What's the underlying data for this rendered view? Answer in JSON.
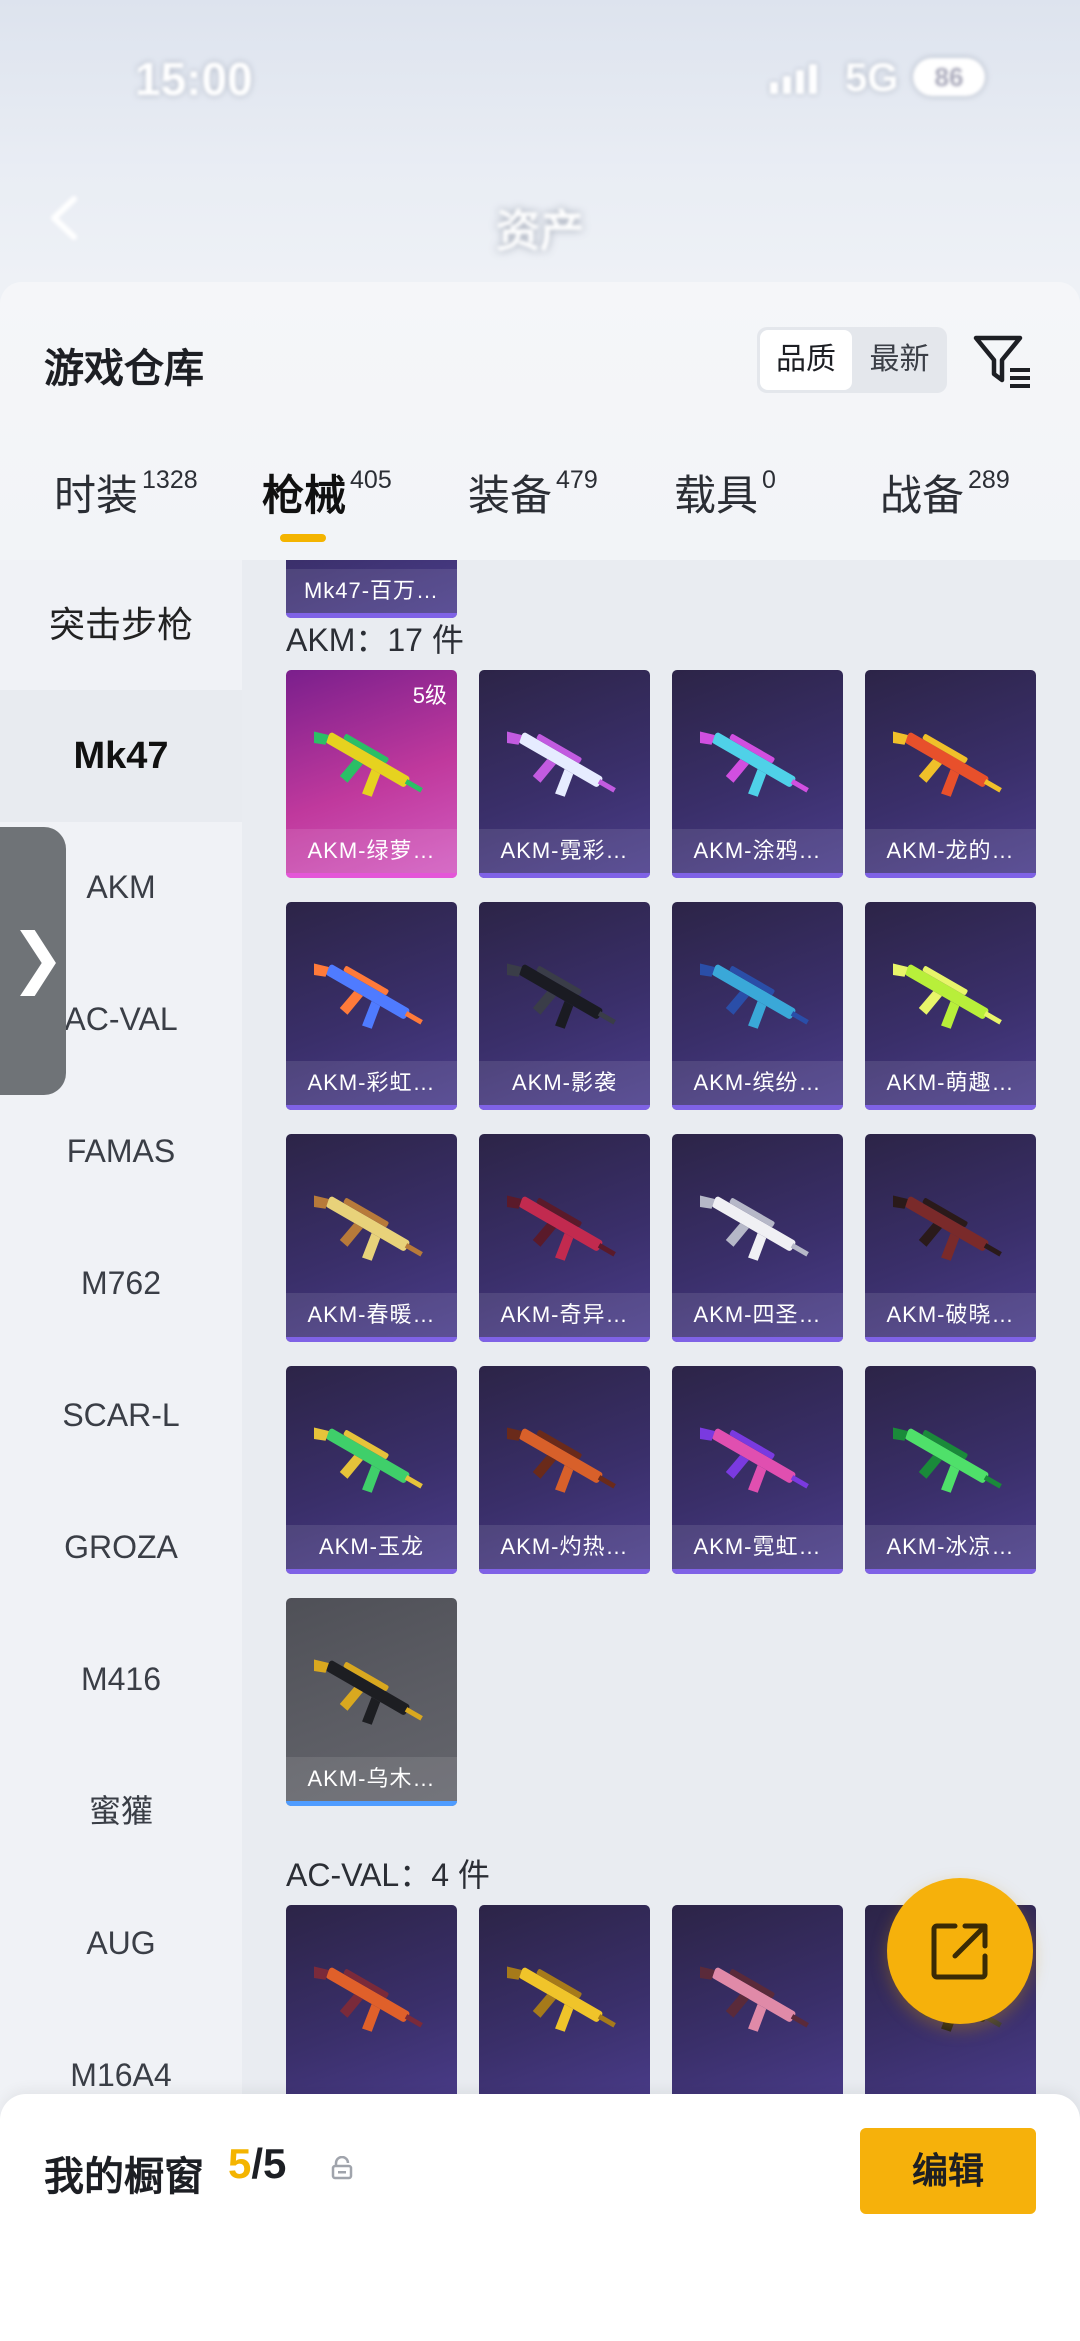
{
  "status_bar": {
    "time": "15:00",
    "network": "5G",
    "battery": "86"
  },
  "nav": {
    "title": "资产"
  },
  "sheet": {
    "title": "游戏仓库",
    "sort": {
      "option_active": "品质",
      "option_other": "最新"
    }
  },
  "tabs": [
    {
      "label": "时装",
      "count": "1328",
      "active": false
    },
    {
      "label": "枪械",
      "count": "405",
      "active": true
    },
    {
      "label": "装备",
      "count": "479",
      "active": false
    },
    {
      "label": "载具",
      "count": "0",
      "active": false
    },
    {
      "label": "战备",
      "count": "289",
      "active": false
    }
  ],
  "sidebar": [
    {
      "label": "突击步枪",
      "active": false
    },
    {
      "label": "Mk47",
      "active": true
    },
    {
      "label": "AKM",
      "active": false
    },
    {
      "label": "AC-VAL",
      "active": false
    },
    {
      "label": "FAMAS",
      "active": false
    },
    {
      "label": "M762",
      "active": false
    },
    {
      "label": "SCAR-L",
      "active": false
    },
    {
      "label": "GROZA",
      "active": false
    },
    {
      "label": "M416",
      "active": false
    },
    {
      "label": "蜜獾",
      "active": false
    },
    {
      "label": "AUG",
      "active": false
    },
    {
      "label": "M16A4",
      "active": false
    }
  ],
  "grid": {
    "prev_item": "Mk47-百万…",
    "groups": [
      {
        "title": "AKM：17 件",
        "items": [
          {
            "name": "AKM-绿萝…",
            "level": "5级",
            "style": "pink",
            "colors": [
              "#e6d21f",
              "#2bbf66"
            ]
          },
          {
            "name": "AKM-霓彩…",
            "style": "purple",
            "colors": [
              "#e6ecff",
              "#c25be0"
            ]
          },
          {
            "name": "AKM-涂鸦…",
            "style": "purple",
            "colors": [
              "#4fd1e8",
              "#d14fe0"
            ]
          },
          {
            "name": "AKM-龙的…",
            "style": "purple",
            "colors": [
              "#e8502b",
              "#f0c02a"
            ]
          },
          {
            "name": "AKM-彩虹…",
            "style": "purple",
            "colors": [
              "#4f7bff",
              "#ff7a3a"
            ]
          },
          {
            "name": "AKM-影袭",
            "style": "purple",
            "colors": [
              "#1a1b22",
              "#3a3d48"
            ]
          },
          {
            "name": "AKM-缤纷…",
            "style": "purple",
            "colors": [
              "#3aa8d8",
              "#2a4ea8"
            ]
          },
          {
            "name": "AKM-萌趣…",
            "style": "purple",
            "colors": [
              "#b8ef3a",
              "#e8f56a"
            ]
          },
          {
            "name": "AKM-春暖…",
            "style": "purple",
            "colors": [
              "#e8d27a",
              "#b77a3a"
            ]
          },
          {
            "name": "AKM-奇异…",
            "style": "purple",
            "colors": [
              "#c22a4f",
              "#5a1a2a"
            ]
          },
          {
            "name": "AKM-四圣…",
            "style": "purple",
            "colors": [
              "#f0f0f4",
              "#b6b8c8"
            ]
          },
          {
            "name": "AKM-破晓…",
            "style": "purple",
            "colors": [
              "#7a2a2a",
              "#2a1a1a"
            ]
          },
          {
            "name": "AKM-玉龙",
            "style": "purple",
            "colors": [
              "#3fcf6a",
              "#e6c33a"
            ]
          },
          {
            "name": "AKM-灼热…",
            "style": "purple",
            "colors": [
              "#d8602a",
              "#6a2a1a"
            ]
          },
          {
            "name": "AKM-霓虹…",
            "style": "purple",
            "colors": [
              "#e04fb0",
              "#7a3ae0"
            ]
          },
          {
            "name": "AKM-冰凉…",
            "style": "purple",
            "colors": [
              "#4fe06a",
              "#1a8a3a"
            ]
          },
          {
            "name": "AKM-乌木…",
            "style": "grey",
            "colors": [
              "#1d1e22",
              "#d9a81f"
            ]
          }
        ]
      },
      {
        "title": "AC-VAL：4 件",
        "items": [
          {
            "colors": [
              "#e0602a",
              "#7a2a3a"
            ]
          },
          {
            "colors": [
              "#f0c42a",
              "#a67a1a"
            ]
          },
          {
            "colors": [
              "#e08aa8",
              "#5a2a3a"
            ]
          },
          {
            "colors": [
              "#1a1a1a",
              "#3a3a3a"
            ]
          }
        ]
      }
    ]
  },
  "bottom_bar": {
    "label": "我的橱窗",
    "count_current": "5",
    "count_total": "/5",
    "edit_label": "编辑"
  }
}
